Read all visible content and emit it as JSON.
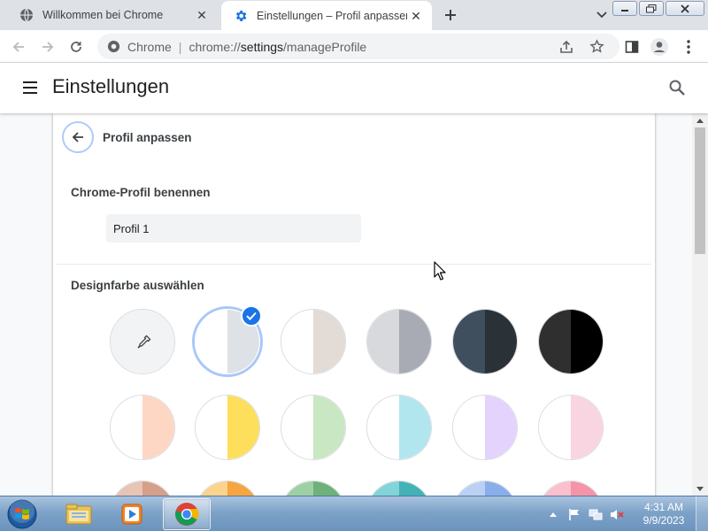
{
  "tabs": [
    {
      "title": "Willkommen bei Chrome",
      "favicon": "globe-icon",
      "active": false
    },
    {
      "title": "Einstellungen – Profil anpassen",
      "favicon": "gear-icon",
      "active": true
    }
  ],
  "toolbar": {
    "site_chip": "Chrome",
    "url_scheme": "chrome://",
    "url_host": "settings",
    "url_path": "/manageProfile"
  },
  "settings": {
    "title": "Einstellungen"
  },
  "page": {
    "subtitle": "Profil anpassen",
    "name_label": "Chrome-Profil benennen",
    "name_value": "Profil 1",
    "color_label": "Designfarbe auswählen"
  },
  "swatches": [
    {
      "id": "custom-color-picker",
      "left": "#f1f3f4",
      "right": "#f1f3f4",
      "selected": false,
      "picker": true
    },
    {
      "id": "default",
      "left": "#ffffff",
      "right": "#dee1e6",
      "selected": true
    },
    {
      "id": "warm-grey",
      "left": "#ffffff",
      "right": "#e3dbd6",
      "selected": false
    },
    {
      "id": "cool-grey",
      "left": "#d8d9dd",
      "right": "#a8abb3",
      "selected": false
    },
    {
      "id": "midnight-blue",
      "left": "#3f4f5e",
      "right": "#2a3238",
      "selected": false
    },
    {
      "id": "black",
      "left": "#2f2f2f",
      "right": "#000000",
      "selected": false
    },
    {
      "id": "beige-and-white",
      "left": "#ffffff",
      "right": "#fdd7c3",
      "selected": false
    },
    {
      "id": "yellow-and-white",
      "left": "#ffffff",
      "right": "#fedf5c",
      "selected": false
    },
    {
      "id": "green-and-white",
      "left": "#ffffff",
      "right": "#c9e7c2",
      "selected": false
    },
    {
      "id": "light-teal-and-white",
      "left": "#ffffff",
      "right": "#b2e6ef",
      "selected": false
    },
    {
      "id": "light-purple-and-white",
      "left": "#ffffff",
      "right": "#e4d3fc",
      "selected": false
    },
    {
      "id": "pink-and-white",
      "left": "#ffffff",
      "right": "#f8d5e1",
      "selected": false
    },
    {
      "id": "beige",
      "left": "#e8c4b4",
      "right": "#d59f8a",
      "selected": false
    },
    {
      "id": "orange",
      "left": "#fcd38c",
      "right": "#f6a540",
      "selected": false
    },
    {
      "id": "light-green",
      "left": "#9fd0a4",
      "right": "#6db278",
      "selected": false
    },
    {
      "id": "light-teal",
      "left": "#83d4d8",
      "right": "#43b2b6",
      "selected": false
    },
    {
      "id": "light-blue",
      "left": "#bcd0f4",
      "right": "#8aaeea",
      "selected": false
    },
    {
      "id": "light-pink",
      "left": "#fbc0cc",
      "right": "#f593a7",
      "selected": false
    }
  ],
  "taskbar": {
    "time": "4:31 AM",
    "date": "9/9/2023",
    "pinned": [
      "explorer-icon",
      "media-player-icon",
      "chrome-icon"
    ]
  },
  "colors": {
    "accent": "#1a73e8",
    "tab_strip": "#dee1e6",
    "taskbar": "#7ea3c9"
  }
}
